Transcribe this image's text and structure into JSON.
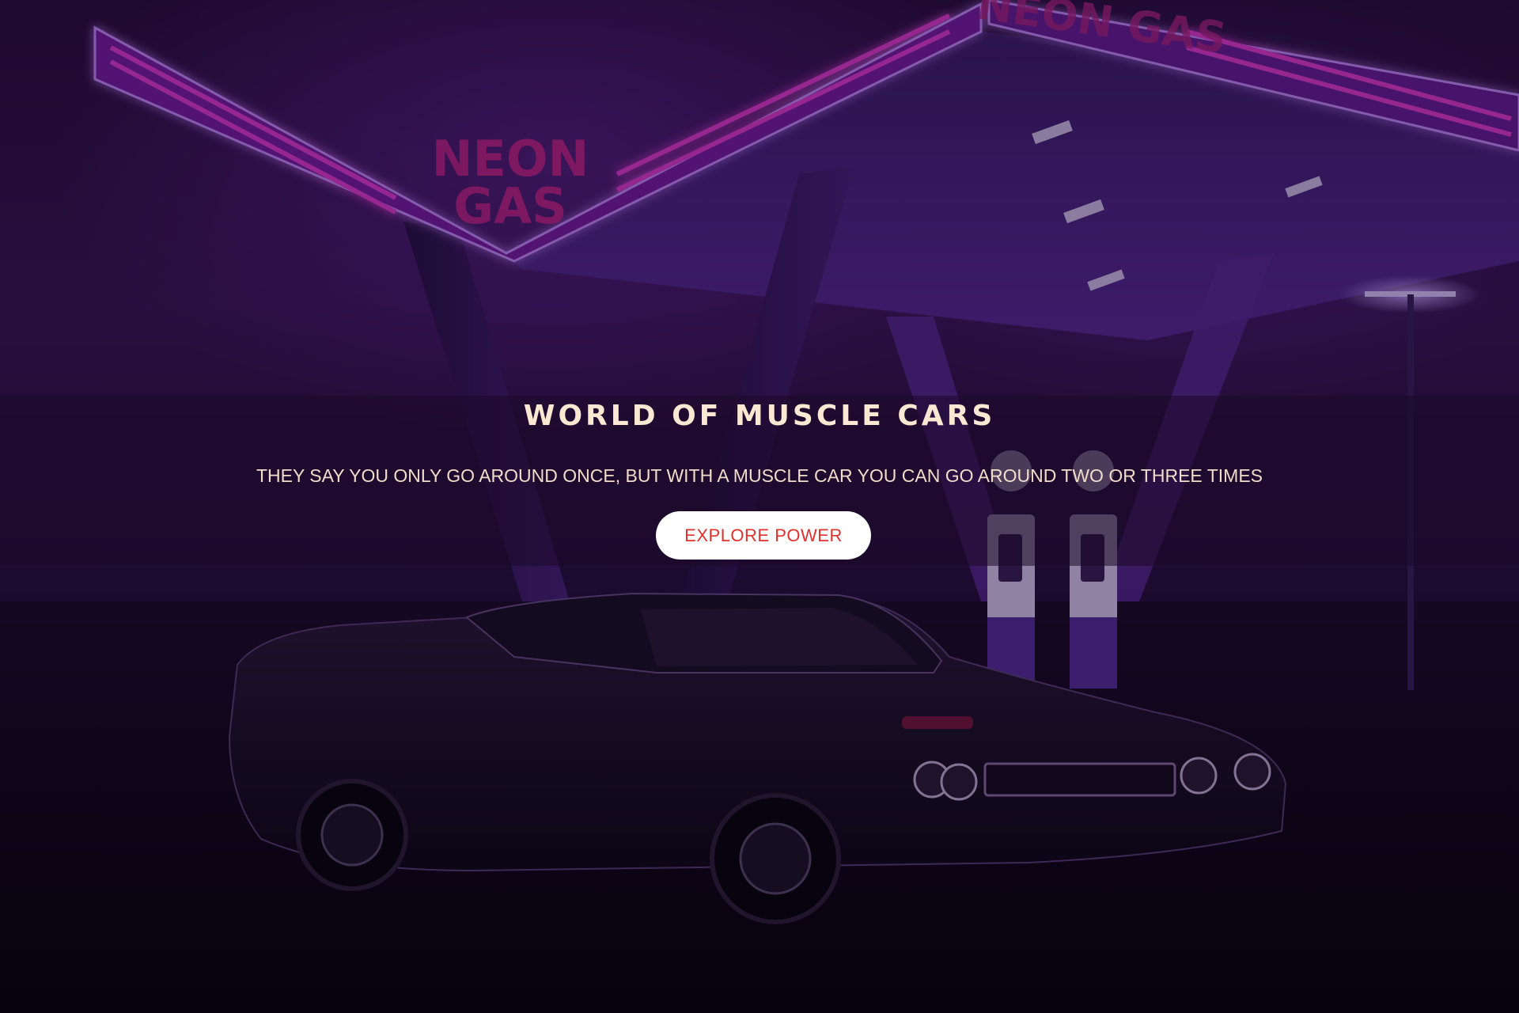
{
  "hero": {
    "title": "WORLD OF MUSCLE CARS",
    "subtitle": "THEY SAY YOU ONLY GO AROUND ONCE, BUT WITH A MUSCLE CAR YOU CAN GO AROUND TWO OR THREE TIMES",
    "cta_label": "EXPLORE POWER",
    "cta_bg": "#ffffff",
    "cta_color": "#e0312c",
    "title_color": "#fbe8d2"
  },
  "background": {
    "sign_text_1": "NEON",
    "sign_text_2": "GAS",
    "sign_text_3": "NEON GAS",
    "neon_color": "#d62bd0",
    "canopy_color": "#6a2fc8"
  }
}
